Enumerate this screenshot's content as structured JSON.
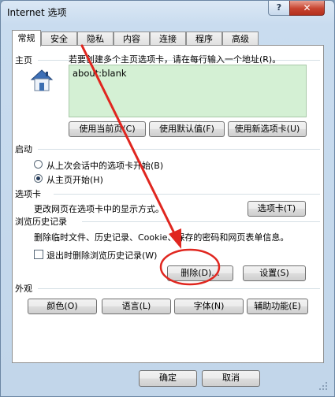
{
  "window": {
    "title": "Internet 选项",
    "help_glyph": "?",
    "close_glyph": "✕"
  },
  "tabs": [
    "常规",
    "安全",
    "隐私",
    "内容",
    "连接",
    "程序",
    "高级"
  ],
  "home": {
    "section_label": "主页",
    "description": "若要创建多个主页选项卡，请在每行输入一个地址(R)。",
    "url": "about:blank",
    "buttons": {
      "use_current": "使用当前页(C)",
      "use_default": "使用默认值(F)",
      "use_new_tab": "使用新选项卡(U)"
    }
  },
  "startup": {
    "section_label": "启动",
    "option_last_session": "从上次会话中的选项卡开始(B)",
    "option_home": "从主页开始(H)",
    "selected": "option_home"
  },
  "tabs_section": {
    "section_label": "选项卡",
    "description": "更改网页在选项卡中的显示方式。",
    "button": "选项卡(T)"
  },
  "history": {
    "section_label": "浏览历史记录",
    "description": "删除临时文件、历史记录、Cookie、保存的密码和网页表单信息。",
    "checkbox_label": "退出时删除浏览历史记录(W)",
    "checkbox_checked": false,
    "delete_button": "删除(D)...",
    "settings_button": "设置(S)"
  },
  "appearance": {
    "section_label": "外观",
    "buttons": [
      "颜色(O)",
      "语言(L)",
      "字体(N)",
      "辅助功能(E)"
    ]
  },
  "footer": {
    "ok": "确定",
    "cancel": "取消"
  },
  "colors": {
    "annotation_red": "#e0261f",
    "home_box_bg": "#d4f0d4"
  }
}
